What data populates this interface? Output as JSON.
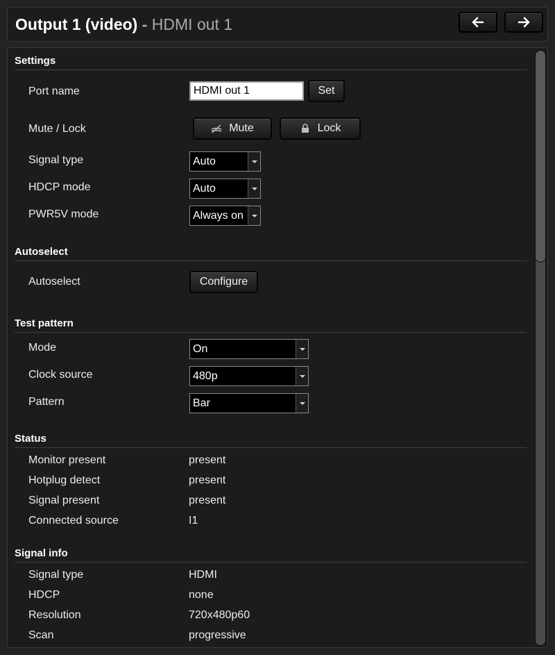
{
  "header": {
    "title": "Output 1 (video)",
    "separator": " - ",
    "subtitle": "HDMI out 1",
    "nav_prev_icon": "arrow-left-icon",
    "nav_next_icon": "arrow-right-icon"
  },
  "settings": {
    "heading": "Settings",
    "port_name": {
      "label": "Port name",
      "value": "HDMI out 1",
      "set_label": "Set"
    },
    "mute_lock": {
      "label": "Mute / Lock",
      "mute_label": "Mute",
      "mute_icon": "mute-icon",
      "lock_label": "Lock",
      "lock_icon": "lock-icon"
    },
    "signal_type": {
      "label": "Signal type",
      "selected": "Auto"
    },
    "hdcp_mode": {
      "label": "HDCP mode",
      "selected": "Auto"
    },
    "pwr5v_mode": {
      "label": "PWR5V mode",
      "selected": "Always on"
    }
  },
  "autoselect": {
    "heading": "Autoselect",
    "label": "Autoselect",
    "configure_label": "Configure"
  },
  "test_pattern": {
    "heading": "Test pattern",
    "mode": {
      "label": "Mode",
      "selected": "On"
    },
    "clock_source": {
      "label": "Clock source",
      "selected": "480p"
    },
    "pattern": {
      "label": "Pattern",
      "selected": "Bar"
    }
  },
  "status": {
    "heading": "Status",
    "rows": [
      {
        "label": "Monitor present",
        "value": "present"
      },
      {
        "label": "Hotplug detect",
        "value": "present"
      },
      {
        "label": "Signal present",
        "value": "present"
      },
      {
        "label": "Connected source",
        "value": "I1"
      }
    ]
  },
  "signal_info": {
    "heading": "Signal info",
    "rows": [
      {
        "label": "Signal type",
        "value": "HDMI"
      },
      {
        "label": "HDCP",
        "value": "none"
      },
      {
        "label": "Resolution",
        "value": "720x480p60"
      },
      {
        "label": "Scan",
        "value": "progressive"
      }
    ]
  },
  "colors": {
    "background": "#232323",
    "panel": "#1c1c1c",
    "text": "#ececec",
    "subtitle": "#a9a9a9"
  }
}
